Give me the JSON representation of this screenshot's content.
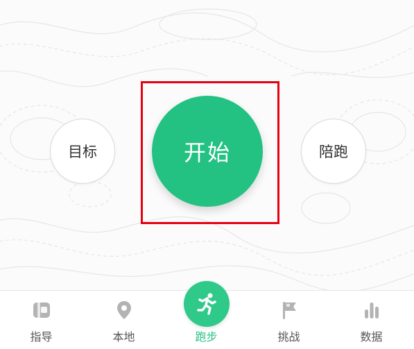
{
  "colors": {
    "accent": "#23c182",
    "highlight": "#e60012",
    "tab_inactive": "#555555",
    "icon_inactive": "#b3b3b3"
  },
  "controls": {
    "goal_label": "目标",
    "start_label": "开始",
    "pace_label": "陪跑"
  },
  "tabbar": {
    "selected": "run",
    "items": [
      {
        "id": "guide",
        "label": "指导",
        "icon": "book-icon"
      },
      {
        "id": "local",
        "label": "本地",
        "icon": "location-pin-icon"
      },
      {
        "id": "run",
        "label": "跑步",
        "icon": "runner-icon"
      },
      {
        "id": "challenge",
        "label": "挑战",
        "icon": "flag-icon"
      },
      {
        "id": "data",
        "label": "数据",
        "icon": "bar-chart-icon"
      }
    ]
  }
}
